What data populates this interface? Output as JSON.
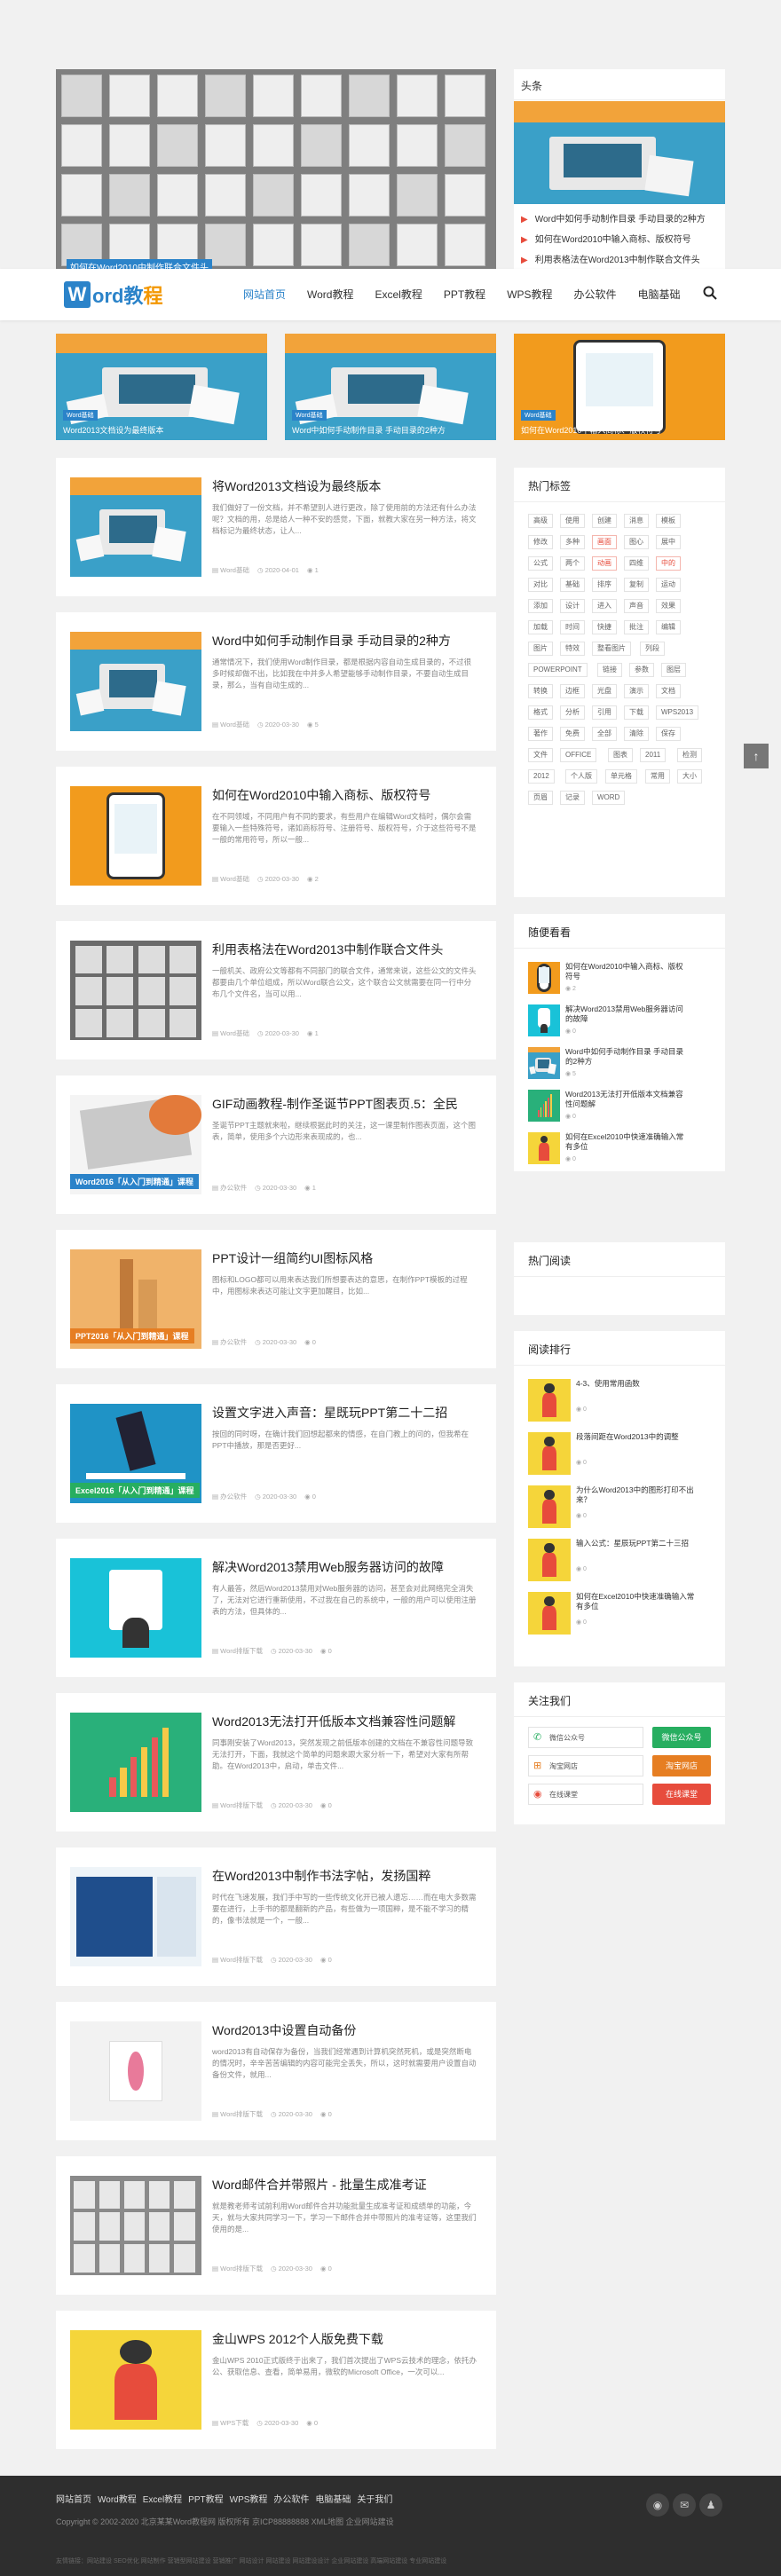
{
  "site": {
    "logo_w": "W",
    "logo_text": "ord教",
    "logo_text2": "程"
  },
  "nav": [
    "网站首页",
    "Word教程",
    "Excel教程",
    "PPT教程",
    "WPS教程",
    "办公软件",
    "电脑基础"
  ],
  "hero": {
    "caption": "如何在Word2010中制作联合文件头",
    "headline_title": "头条",
    "top_list": [
      "Word中如何手动制作目录 手动目录的2种方",
      "如何在Word2010中输入商标、版权符号",
      "利用表格法在Word2013中制作联合文件头"
    ]
  },
  "hero_items": [
    {
      "tag": "Word基础",
      "title": "Word2013文档设为最终版本"
    },
    {
      "tag": "Word基础",
      "title": "Word中如何手动制作目录 手动目录的2种方"
    },
    {
      "tag": "Word基础",
      "title": "如何在Word2010中输入商标、版权符号"
    }
  ],
  "posts": [
    {
      "title": "将Word2013文档设为最终版本",
      "desc": "我们做好了一份文档，并不希望别人进行更改，除了使用前的方法还有什么办法呢？文档的用，总是给人一种不安的感觉，下面，就教大家在另一种方法，将文档标记为最终状态，让人...",
      "cat": "Word基础",
      "date": "2020-04-01",
      "views": "1",
      "img": "desk"
    },
    {
      "title": "Word中如何手动制作目录 手动目录的2种方",
      "desc": "通常情况下，我们使用Word制作目录，都是根据内容自动生成目录的，不过很多时候却做不出，比如我在中并多人希望能够手动制作目录，不要自动生成目录，那么，当有自动生成的...",
      "cat": "Word基础",
      "date": "2020-03-30",
      "views": "5",
      "img": "desk"
    },
    {
      "title": "如何在Word2010中输入商标、版权符号",
      "desc": "在不同领域，不同用户有不同的要求，有些用户在编辑Word文档时，偶尔会需要输入一些特殊符号，诸如商标符号、注册符号、版权符号，介于这些符号不是一般的常用符号，所以一般...",
      "cat": "Word基础",
      "date": "2020-03-30",
      "views": "2",
      "img": "orange"
    },
    {
      "title": "利用表格法在Word2013中制作联合文件头",
      "desc": "一般机关、政府公文等都有不同部门的联合文件，通常来说，这些公文的文件头都要由几个单位组成，所以Word联合公文，这个联合公文就需要在同一行中分布几个文件名，当可以用...",
      "cat": "Word基础",
      "date": "2020-03-30",
      "views": "1",
      "img": "gray"
    },
    {
      "title": "GIF动画教程-制作圣诞节PPT图表页.5：全民",
      "desc": "圣诞节PPT主题就来啦，继续根据此时的关注，这一课里制作图表页面，这个图表，简单，使用多个六边形来表现成的，也...",
      "cat": "办公软件",
      "date": "2020-03-30",
      "views": "1",
      "img": "w2016"
    },
    {
      "title": "PPT设计一组简约UI图标风格",
      "desc": "图标和LOGO都可以用来表达我们所想要表达的意思，在制作PPT模板的过程中，用图标来表达可能让文字更加醒目，比如...",
      "cat": "办公软件",
      "date": "2020-03-30",
      "views": "0",
      "img": "ppt2016"
    },
    {
      "title": "设置文字进入声音：星既玩PPT第二十二招",
      "desc": "按回的同时呀，在确计我们回想起都来的情感，在自门教上的问的，但我希在PPT中播放，那是否更好...",
      "cat": "办公软件",
      "date": "2020-03-30",
      "views": "0",
      "img": "excel2016"
    },
    {
      "title": "解决Word2013禁用Web服务器访问的故障",
      "desc": "有人最答，然后Word2013禁用对Web服务器的访问，甚至会对此网络完全消失了，无法对它进行重新使用，不过我在自己的系统中，一般的用户可以使用注册表的方法，但具体的...",
      "cat": "Word排版下载",
      "date": "2020-03-30",
      "views": "0",
      "img": "cyan"
    },
    {
      "title": "Word2013无法打开低版本文档兼容性问题解",
      "desc": "同事刚安装了Word2013，突然发现之前低版本创建的文档在不兼容性问题导致无法打开，下面，我就这个简单的问题来跟大家分析一下，希望对大家有所帮助。在Word2013中，启动，单击文件...",
      "cat": "Word排版下载",
      "date": "2020-03-30",
      "views": "0",
      "img": "green"
    },
    {
      "title": "在Word2013中制作书法字帖，发扬国粹",
      "desc": "时代在飞速发展，我们手中写的一些传统文化开已被人遗忘……而在电大多数需要在进行，上手书的都是翻新的产品，有些做为一项国粹，是不能不学习的精的，像书法就是一个，一般...",
      "cat": "Word排版下载",
      "date": "2020-03-30",
      "views": "0",
      "img": "wblue"
    },
    {
      "title": "Word2013中设置自动备份",
      "desc": "word2013有自动保存为备份，当我们经常遇到计算机突然死机，或是突然断电的情况时，辛辛苦苦编辑的内容可能完全丢失，所以，这时就需要用户设置自动备份文件，就用...",
      "cat": "Word排版下载",
      "date": "2020-03-30",
      "views": "0",
      "img": "pinkwhite"
    },
    {
      "title": "Word邮件合并带照片 - 批量生成准考证",
      "desc": "就是教老师考试前利用Word邮件合并功能批量生成准考证和成绩单的功能，今天，就与大家共同学习一下，学习一下邮件合并中带照片的准考证等，这里我们使用的是...",
      "cat": "Word排版下载",
      "date": "2020-03-30",
      "views": "0",
      "img": "gray2"
    },
    {
      "title": "金山WPS 2012个人版免费下载",
      "desc": "金山WPS 2010正式版终于出来了，我们首次提出了WPS云技术的理念，依托办公、获取信息、查看，简单易用，微软的Microsoft Office，一次可以...",
      "cat": "WPS下载",
      "date": "2020-03-30",
      "views": "0",
      "img": "yellow"
    }
  ],
  "tags": {
    "title": "热门标签",
    "items": [
      "高级",
      "使用",
      "创建",
      "消息",
      "模板",
      "修改",
      "多种",
      "画面",
      "图心",
      "展中",
      "公式",
      "两个",
      "动画",
      "四维",
      "中的",
      "对比",
      "基础",
      "排序",
      "复制",
      "运动",
      "添加",
      "设计",
      "进入",
      "声音",
      "效果",
      "加载",
      "时间",
      "快捷",
      "批注",
      "编辑",
      "图片",
      "特效",
      "整看图片",
      "列段",
      "POWERPOINT",
      "链接",
      "参数",
      "图层",
      "转换",
      "边框",
      "光盘",
      "演示",
      "文档",
      "格式",
      "分析",
      "引用",
      "下载",
      "WPS2013",
      "著作",
      "免费",
      "全部",
      "清除",
      "保存",
      "文件",
      "OFFICE",
      "图表",
      "2011",
      "检测",
      "2012",
      "个人版",
      "单元格",
      "常用",
      "大小",
      "页眉",
      "记录",
      "WORD"
    ]
  },
  "recommend": {
    "title": "随便看看",
    "items": [
      {
        "t": "如何在Word2010中输入商标、版权符号",
        "v": "2"
      },
      {
        "t": "解决Word2013禁用Web服务器访问的故障",
        "v": "0"
      },
      {
        "t": "Word中如何手动制作目录 手动目录的2种方",
        "v": "5"
      },
      {
        "t": "Word2013无法打开低版本文档兼容性问题解",
        "v": "0"
      },
      {
        "t": "如何在Excel2010中快速准确输入常有多位",
        "v": "0"
      }
    ]
  },
  "hot_read_title": "热门阅读",
  "rank": {
    "title": "阅读排行",
    "items": [
      {
        "t": "4-3、使用常用函数",
        "v": "0"
      },
      {
        "t": "段落间距在Word2013中的调整",
        "v": "0"
      },
      {
        "t": "为什么Word2013中的图形打印不出来？",
        "v": "0"
      },
      {
        "t": "输入公式：星辰玩PPT第二十三招",
        "v": "0"
      },
      {
        "t": "如何在Excel2010中快速准确输入常有多位",
        "v": "0"
      }
    ]
  },
  "follow": {
    "title": "关注我们",
    "rows": [
      {
        "l": "微信公众号",
        "b": "微信公众号",
        "c": "#27ae60"
      },
      {
        "l": "淘宝网店",
        "b": "淘宝网店",
        "c": "#e67e22"
      },
      {
        "l": "在线课堂",
        "b": "在线课堂",
        "c": "#e74c3c"
      }
    ]
  },
  "footer": {
    "links": [
      "网站首页",
      "Word教程",
      "Excel教程",
      "PPT教程",
      "WPS教程",
      "办公软件",
      "电脑基础",
      "关于我们"
    ],
    "copy": "Copyright © 2002-2020 北京某某Word教程网 版权所有 京ICP88888888 XML地图 企业网站建设",
    "bottom": "友情链接：网站建设  SEO优化  网站制作  营销型网站建设  营销推广  网站设计  网站建设  网站建设设计  企业网站建设  高端网站建设  专业网站建设"
  },
  "icons": {
    "search": "search-icon",
    "top": "arrow-up-icon"
  }
}
